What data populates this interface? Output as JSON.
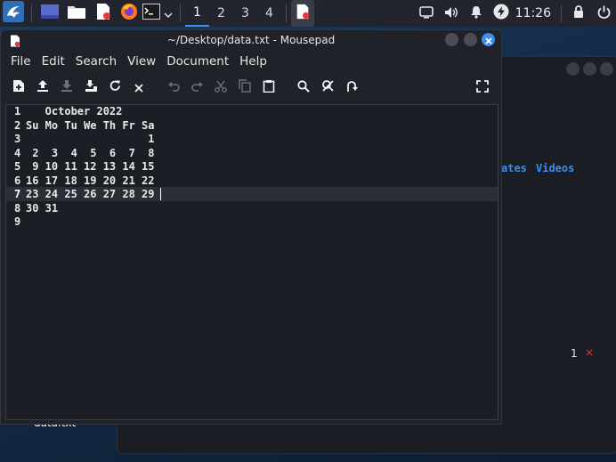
{
  "panel": {
    "workspaces": [
      "1",
      "2",
      "3",
      "4"
    ],
    "active_workspace": "1",
    "clock": "11:26"
  },
  "window": {
    "title": "~/Desktop/data.txt - Mousepad"
  },
  "menu": [
    "File",
    "Edit",
    "Search",
    "View",
    "Document",
    "Help"
  ],
  "editor": {
    "line_numbers": [
      "1",
      "2",
      "3",
      "4",
      "5",
      "6",
      "7",
      "8",
      "9"
    ],
    "lines": [
      "   October 2022",
      "Su Mo Tu We Th Fr Sa",
      "                   1",
      " 2  3  4  5  6  7  8",
      " 9 10 11 12 13 14 15",
      "16 17 18 19 20 21 22",
      "23 24 25 26 27 28 29",
      "30 31",
      ""
    ],
    "current_line": "7"
  },
  "background_window": {
    "link1": "ates",
    "link2": "Videos",
    "count": "1",
    "close_mark": "×"
  },
  "desktop": {
    "file_label": "data.txt"
  },
  "colors": {
    "accent": "#3b8eea",
    "panel": "#23252e",
    "editor_bg": "#1c1e25"
  }
}
